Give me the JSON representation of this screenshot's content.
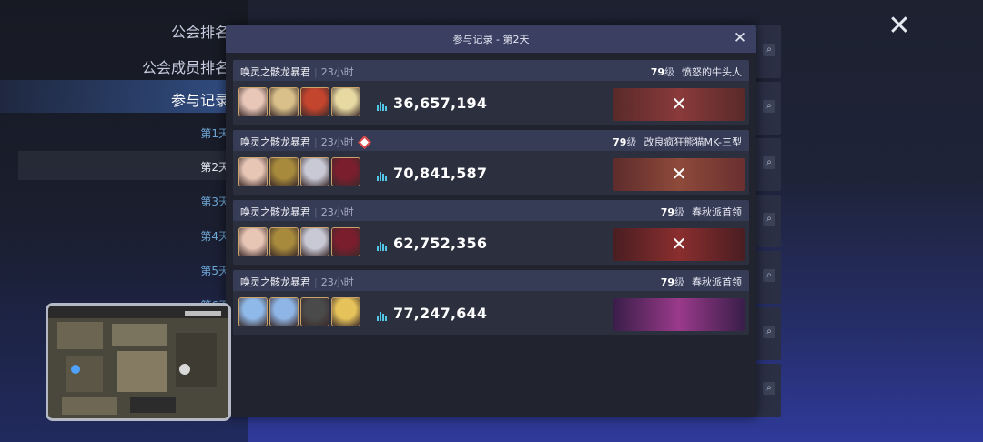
{
  "sidebar": {
    "items": [
      {
        "label": "公会排名"
      },
      {
        "label": "公会成员排名"
      },
      {
        "label": "参与记录"
      }
    ],
    "days": [
      "第1天",
      "第2天",
      "第3天",
      "第4天",
      "第5天",
      "第6天"
    ]
  },
  "modal": {
    "title": "参与记录 - 第2天",
    "entries": [
      {
        "boss": "唤灵之骸龙暴君",
        "time": "23小时",
        "has_badge": false,
        "level": "79",
        "level_unit": "级",
        "target": "愤怒的牛头人",
        "damage": "36,657,194",
        "defeated": true
      },
      {
        "boss": "唤灵之骸龙暴君",
        "time": "23小时",
        "has_badge": true,
        "level": "79",
        "level_unit": "级",
        "target": "改良疯狂熊猫MK-三型",
        "damage": "70,841,587",
        "defeated": true
      },
      {
        "boss": "唤灵之骸龙暴君",
        "time": "23小时",
        "has_badge": false,
        "level": "79",
        "level_unit": "级",
        "target": "春秋派首领",
        "damage": "62,752,356",
        "defeated": true
      },
      {
        "boss": "唤灵之骸龙暴君",
        "time": "23小时",
        "has_badge": false,
        "level": "79",
        "level_unit": "级",
        "target": "春秋派首领",
        "damage": "77,247,644",
        "defeated": false
      }
    ]
  },
  "icons": {
    "close": "close-icon",
    "search": "search-icon",
    "damage": "bar-chart-icon",
    "defeated": "x-mark-icon",
    "badge": "crown-badge-icon"
  },
  "colors": {
    "accent": "#52c7e8",
    "modal_header": "#3b4063",
    "entry_header": "#363b56"
  }
}
